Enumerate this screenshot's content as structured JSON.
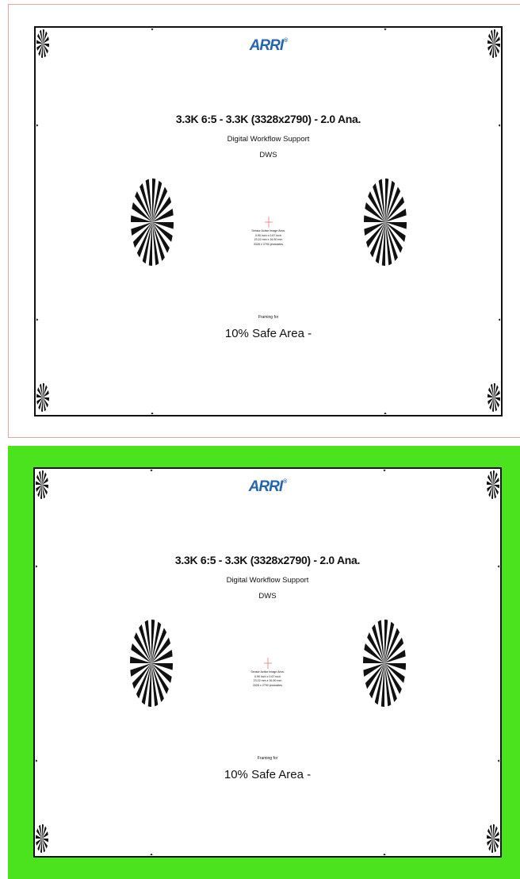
{
  "logo": {
    "text": "ARRI",
    "mark": "®",
    "color": "#2565ae"
  },
  "title": "3.3K 6:5 - 3.3K (3328x2790) - 2.0 Ana.",
  "subtitle": "Digital Workflow Support",
  "acronym": "DWS",
  "sensor_info": [
    "Sensor Active Image Area:",
    "0.90 inch x 0.67 inch",
    "23.22 mm x 16.90 mm",
    "3328 x 2790 photosites"
  ],
  "framing_label": "Framing for",
  "safe_area_label": "10% Safe Area -",
  "colors": {
    "top_border": "#e9a3a3",
    "bottom_background": "#4be31d",
    "crosshair": "#e05050"
  }
}
